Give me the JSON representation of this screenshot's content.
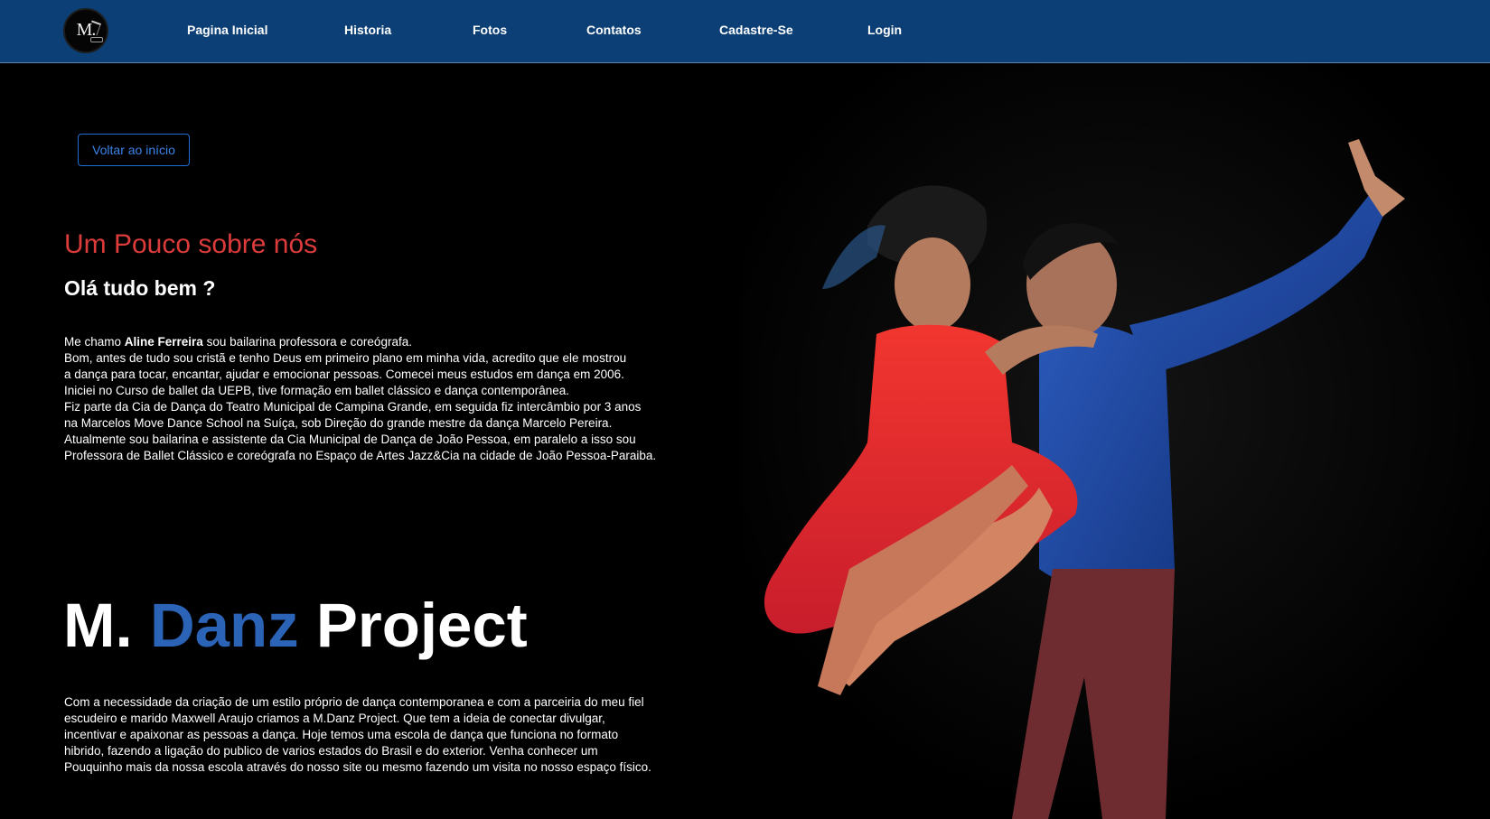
{
  "nav": {
    "logo_text": "M.",
    "links": [
      {
        "label": "Pagina Inicial"
      },
      {
        "label": "Historia"
      },
      {
        "label": "Fotos"
      },
      {
        "label": "Contatos"
      },
      {
        "label": "Cadastre-Se"
      },
      {
        "label": "Login"
      }
    ]
  },
  "hero": {
    "back_button": "Voltar ao início",
    "section_title": "Um Pouco sobre nós",
    "subtitle": "Olá tudo bem ?",
    "about_intro_pre": "Me chamo ",
    "about_name": "Aline Ferreira",
    "about_intro_post": " sou bailarina professora e coreógrafa.",
    "about_lines": [
      "Bom, antes de tudo sou cristã e tenho Deus em primeiro plano em minha vida, acredito que ele mostrou",
      "a dança para tocar, encantar, ajudar e emocionar pessoas. Comecei meus estudos em dança em 2006.",
      "Iniciei no Curso de ballet da UEPB, tive formação em ballet clássico e dança contemporânea.",
      "Fiz parte da Cia de Dança do Teatro Municipal de Campina Grande, em seguida fiz intercâmbio por 3 anos",
      "na Marcelos Move Dance School na Suíça, sob Direção do grande mestre da dança Marcelo Pereira.",
      "Atualmente sou bailarina e assistente da Cia Municipal de Dança de João Pessoa, em paralelo a isso sou",
      "Professora de Ballet Clássico e coreógrafa no Espaço de Artes Jazz&Cia na cidade de João Pessoa-Paraiba."
    ]
  },
  "project": {
    "brand_part1": "M. ",
    "brand_part2": "Danz",
    "brand_part3": " Project",
    "lines": [
      "Com a necessidade da criação de um estilo próprio de dança contemporanea e com a parceiria do meu fiel",
      "escudeiro e marido Maxwell Araujo criamos a M.Danz Project. Que tem a ideia de conectar divulgar,",
      "incentivar e apaixonar as pessoas a dança. Hoje temos uma escola de dança que funciona no formato",
      "hibrido, fazendo a ligação do publico de varios estados do Brasil e do exterior. Venha conhecer um",
      "Pouquinho mais da nossa escola através do nosso site ou mesmo fazendo um visita no nosso espaço físico."
    ]
  },
  "colors": {
    "navbar": "#0c3f75",
    "accent_red": "#dc3b3b",
    "accent_blue": "#2b63b7",
    "button_blue": "#1d6ed8"
  },
  "icons": [
    "logo-icon"
  ]
}
